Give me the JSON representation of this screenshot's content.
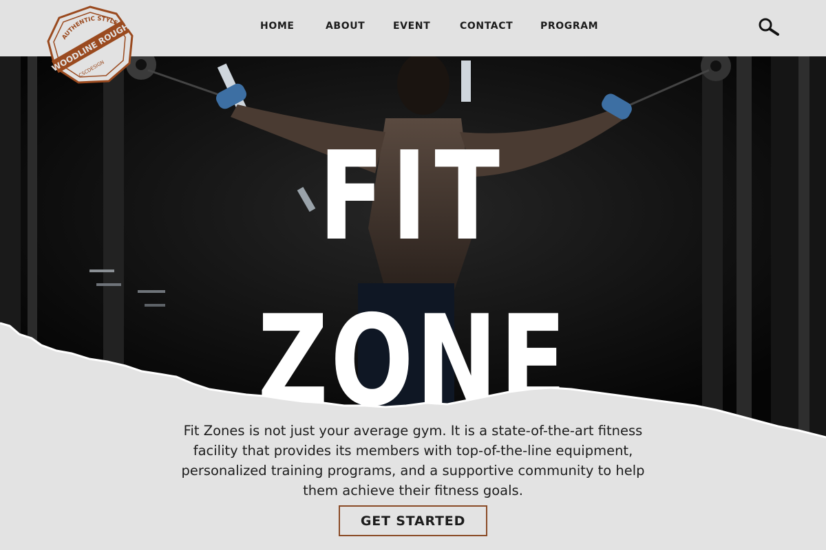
{
  "logo": {
    "arc_text": "AUTHENTIC STYLE",
    "main_text": "WOODLINE ROUGH",
    "sub_text": "CSCDESIGN",
    "color": "#9a4a1f"
  },
  "nav": {
    "items": [
      {
        "label": "HOME"
      },
      {
        "label": "ABOUT"
      },
      {
        "label": "EVENT"
      },
      {
        "label": "CONTACT"
      },
      {
        "label": "PROGRAM"
      }
    ],
    "search_icon": "search-icon"
  },
  "hero": {
    "title_line1": "FIT",
    "title_line2": "ZONE"
  },
  "content": {
    "description": "Fit Zones is not just your average gym. It is a state-of-the-art fitness facility that provides its members with top-of-the-line equipment, personalized training programs, and a supportive community to help them achieve their fitness goals.",
    "cta_label": "GET STARTED"
  },
  "colors": {
    "background": "#e3e3e3",
    "accent": "#8a4a25",
    "hero_dark": "#0b0b0b"
  }
}
